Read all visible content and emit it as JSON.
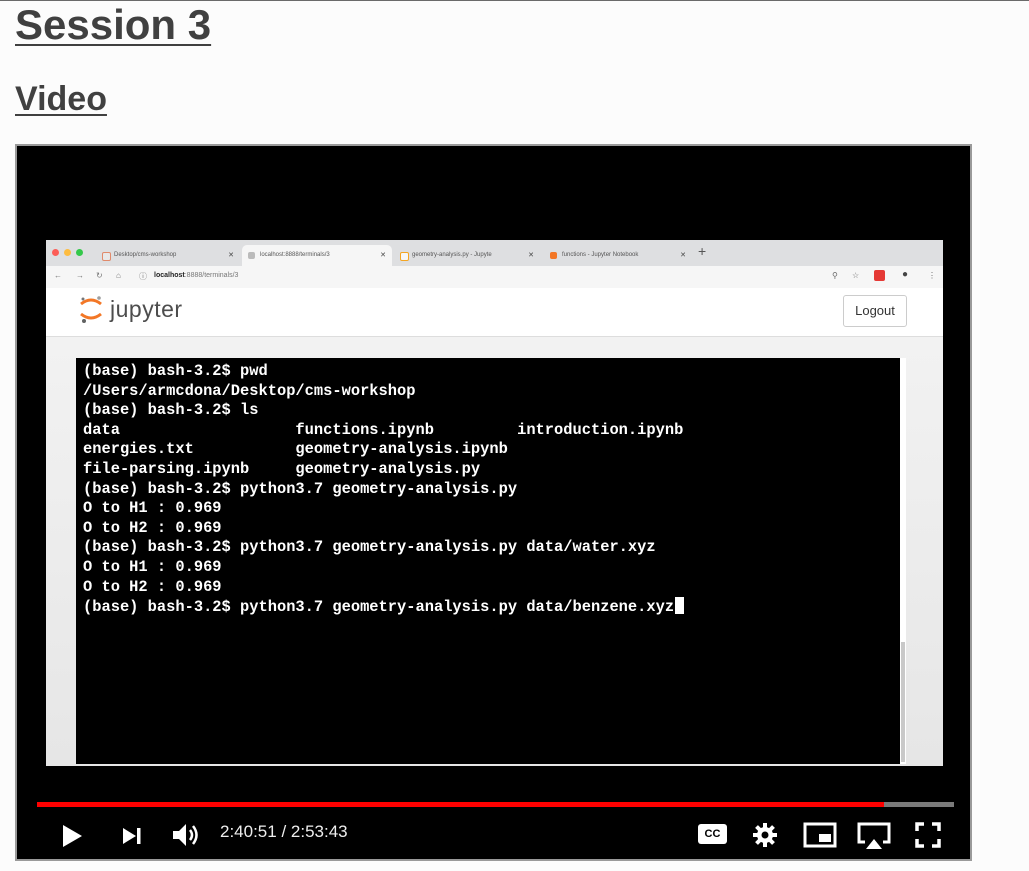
{
  "page": {
    "title": "Session 3",
    "subtitle": "Video"
  },
  "browser": {
    "tabs": [
      {
        "label": "Desktop/cms-workshop",
        "active": false
      },
      {
        "label": "localhost:8888/terminals/3",
        "active": true
      },
      {
        "label": "geometry-analysis.py - Jupyte",
        "active": false
      },
      {
        "label": "functions - Jupyter Notebook",
        "active": false
      }
    ],
    "url_host": "localhost",
    "url_rest": ":8888/terminals/3"
  },
  "jupyter": {
    "logo_text": "jupyter",
    "logout_label": "Logout"
  },
  "terminal": {
    "lines": [
      "(base) bash-3.2$ pwd",
      "/Users/armcdona/Desktop/cms-workshop",
      "(base) bash-3.2$ ls",
      "data                   functions.ipynb         introduction.ipynb",
      "energies.txt           geometry-analysis.ipynb",
      "file-parsing.ipynb     geometry-analysis.py",
      "(base) bash-3.2$ python3.7 geometry-analysis.py",
      "O to H1 : 0.969",
      "O to H2 : 0.969",
      "(base) bash-3.2$ python3.7 geometry-analysis.py data/water.xyz",
      "O to H1 : 0.969",
      "O to H2 : 0.969",
      "(base) bash-3.2$ python3.7 geometry-analysis.py data/benzene.xyz"
    ]
  },
  "player": {
    "time_display": "2:40:51 / 2:53:43",
    "progress_fraction": 0.924,
    "cc_label": "CC",
    "accent_color": "#ff0000"
  }
}
